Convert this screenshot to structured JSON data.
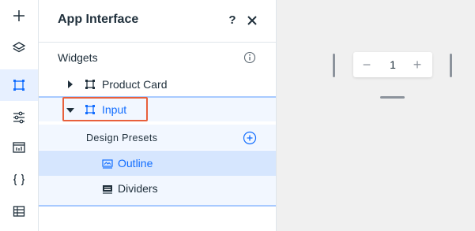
{
  "rail": {
    "items": [
      {
        "icon": "plus-icon",
        "active": false
      },
      {
        "icon": "layers-icon",
        "active": false
      },
      {
        "icon": "widget-frame-icon",
        "active": true
      },
      {
        "icon": "sliders-icon",
        "active": false
      },
      {
        "icon": "table-dashboard-icon",
        "active": false
      },
      {
        "icon": "code-braces-icon",
        "active": false
      },
      {
        "icon": "grid-table-icon",
        "active": false
      }
    ]
  },
  "panel": {
    "title": "App Interface",
    "help_label": "?",
    "section_label": "Widgets",
    "tree": {
      "product_card": "Product Card",
      "input": "Input",
      "design_presets": "Design Presets",
      "outline": "Outline",
      "dividers": "Dividers"
    }
  },
  "canvas": {
    "stepper": {
      "minus": "−",
      "value": "1",
      "plus": "+"
    }
  },
  "colors": {
    "accent": "#116dff",
    "highlight_border": "#e8603c",
    "selected_row": "#d6e6fe",
    "group_bg": "#f2f7ff",
    "canvas_bg": "#f0f0f0"
  }
}
